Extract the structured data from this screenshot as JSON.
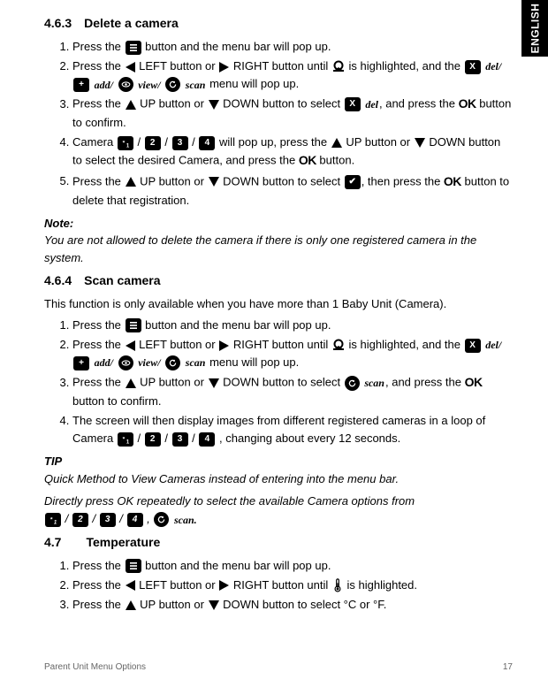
{
  "language_tab": "ENGLISH",
  "s463": {
    "num": "4.6.3",
    "title": "Delete a camera",
    "steps": [
      {
        "a": "Press the ",
        "b": " button and the menu bar will pop up."
      },
      {
        "a": "Press the ",
        "b": " LEFT button or ",
        "c": " RIGHT button until ",
        "d": " is highlighted, and the ",
        "e": " menu will pop up."
      },
      {
        "a": "Press the ",
        "b": " UP button or ",
        "c": " DOWN button to select ",
        "d": ", and press the ",
        "e": " button to confirm."
      },
      {
        "a": "Camera ",
        "b": " will pop up, press the ",
        "c": " UP button or ",
        "d": " DOWN button to select the desired Camera, and press the ",
        "e": " button."
      },
      {
        "a": "Press the ",
        "b": " UP button or ",
        "c": " DOWN button to select ",
        "d": ", then press the ",
        "e": " button to delete that registration."
      }
    ],
    "note_h": "Note:",
    "note": "You are not allowed to delete the camera if there is only one registered camera in the system."
  },
  "s464": {
    "num": "4.6.4",
    "title": "Scan camera",
    "intro": "This function is only available when you have more than 1 Baby Unit (Camera).",
    "steps": [
      {
        "a": "Press the ",
        "b": " button and the menu bar will pop up."
      },
      {
        "a": "Press the ",
        "b": " LEFT button or ",
        "c": " RIGHT button until ",
        "d": " is highlighted, and the ",
        "e": " menu will pop up."
      },
      {
        "a": "Press the ",
        "b": " UP button or ",
        "c": " DOWN button to select ",
        "d": ", and press the ",
        "e": " button to confirm."
      },
      {
        "a": "The screen will then display images from different registered cameras in a loop of Camera ",
        "b": " , changing about every 12 seconds."
      }
    ],
    "tip_h": "TIP",
    "tip1": "Quick Method to View Cameras instead of entering into the menu bar.",
    "tip2a": "Directly press OK repeatedly to select the available Camera options from ",
    "tip2b": "."
  },
  "s47": {
    "num": "4.7",
    "title": "Temperature",
    "steps": [
      {
        "a": "Press the ",
        "b": " button and the menu bar will pop up."
      },
      {
        "a": "Press the ",
        "b": " LEFT button or ",
        "c": " RIGHT button until ",
        "d": " is highlighted."
      },
      {
        "a": "Press the ",
        "b": " UP button or ",
        "c": " DOWN button to select °C or °F."
      }
    ]
  },
  "labels": {
    "del": "del",
    "add": "add",
    "view": "view",
    "scan": "scan",
    "del_slash": "del/",
    "add_slash": "add/",
    "view_slash": "view/",
    "scan_comma": "scan,",
    "scan_dot": "scan."
  },
  "icons": {
    "menu": "≡",
    "x": "X",
    "plus": "+",
    "eye": "👁",
    "scan": "⟳",
    "n1": "*₁",
    "n2": "2",
    "n3": "3",
    "n4": "4",
    "check": "✔"
  },
  "footer": {
    "title": "Parent Unit Menu Options",
    "page": "17"
  }
}
